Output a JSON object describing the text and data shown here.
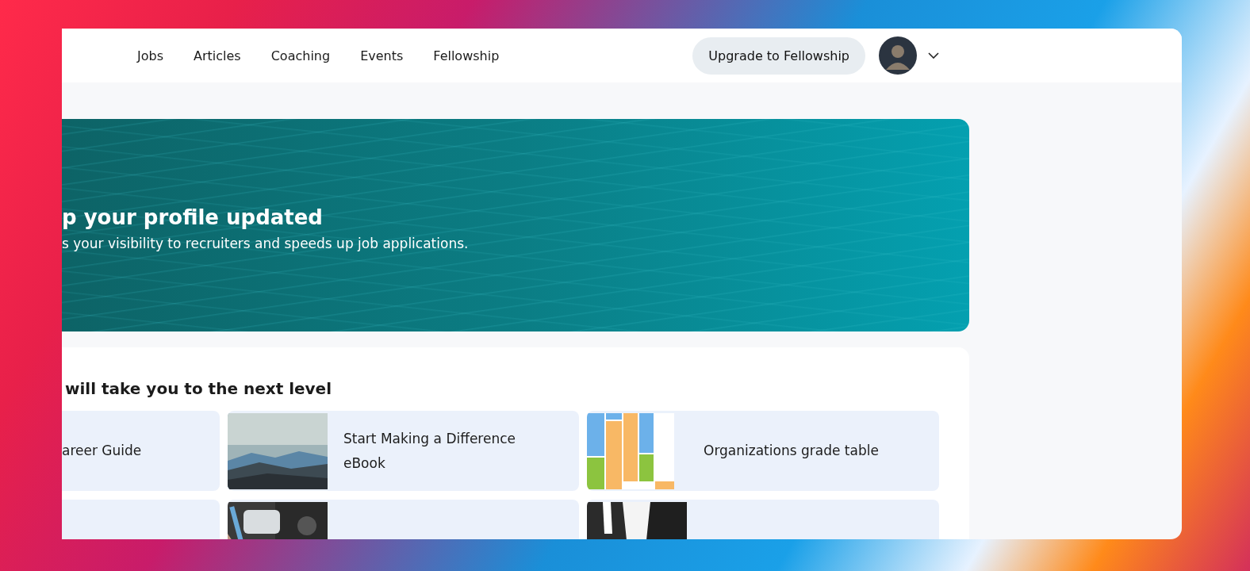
{
  "nav": {
    "links": [
      "Jobs",
      "Articles",
      "Coaching",
      "Events",
      "Fellowship"
    ],
    "upgrade_button": "Upgrade to Fellowship"
  },
  "banner": {
    "title": "p your profile updated",
    "text": "s your visibility to recruiters and speeds up job applications."
  },
  "resources": {
    "heading": "will take you to the next level",
    "cards": [
      {
        "title": "areer Guide",
        "kind": "text"
      },
      {
        "title": "Start Making a Difference eBook",
        "kind": "picture"
      },
      {
        "title": "Organizations grade table",
        "kind": "picture"
      },
      {
        "kind": "text"
      },
      {
        "kind": "picture"
      },
      {
        "kind": "picture"
      }
    ]
  }
}
